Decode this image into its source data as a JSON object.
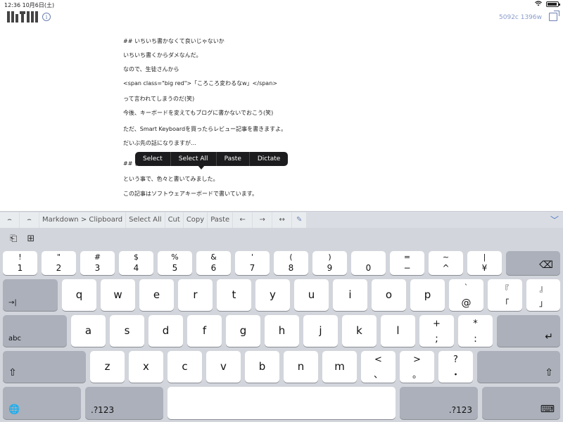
{
  "status_bar": {
    "time": "12:36",
    "date": "10月6日(土)"
  },
  "header": {
    "wordcount": "5092c 1396w"
  },
  "document": {
    "lines": [
      "## いちいち書かなくて良いじゃないか",
      "いちいち書くからダメなんだ。",
      "なので、生徒さんから",
      "<span class=\"big red\">「ころころ変わるなw」</span>",
      "って言われてしまうのだ(笑)",
      "今後、キーボードを変えてもブログに書かないでおこう(笑)",
      "ただ、Smart Keyboardを買ったらレビュー記事を書きますよ。",
      "だいぶ先の話になりますが…",
      "## ま",
      "という事で、色々と書いてみました。",
      "この記事はソフトウェアキーボードで書いています。"
    ]
  },
  "context_menu": [
    "Select",
    "Select All",
    "Paste",
    "Dictate"
  ],
  "toolbar": {
    "undo": "⌢",
    "redo": "⌢",
    "markdown": "Markdown > Clipboard",
    "select_all": "Select All",
    "cut": "Cut",
    "copy": "Copy",
    "paste": "Paste",
    "left": "←",
    "right": "→",
    "both": "↔",
    "pen": "✎",
    "collapse": "﹀"
  },
  "keyboard": {
    "tools": {
      "paste_icon": "⎗",
      "add_icon": "⊞"
    },
    "row1": [
      {
        "top": "!",
        "bot": "1"
      },
      {
        "top": "\"",
        "bot": "2"
      },
      {
        "top": "#",
        "bot": "3"
      },
      {
        "top": "$",
        "bot": "4"
      },
      {
        "top": "%",
        "bot": "5"
      },
      {
        "top": "&",
        "bot": "6"
      },
      {
        "top": "'",
        "bot": "7"
      },
      {
        "top": "(",
        "bot": "8"
      },
      {
        "top": ")",
        "bot": "9"
      },
      {
        "top": "",
        "bot": "0"
      },
      {
        "top": "=",
        "bot": "−"
      },
      {
        "top": "~",
        "bot": "^"
      },
      {
        "top": "|",
        "bot": "¥"
      }
    ],
    "delete": "⌫",
    "row2": [
      "q",
      "w",
      "e",
      "r",
      "t",
      "y",
      "u",
      "i",
      "o",
      "p"
    ],
    "row2_extra": [
      {
        "top": "`",
        "bot": "@"
      },
      {
        "top": "『",
        "bot": "「"
      },
      {
        "top": "』",
        "bot": "」"
      }
    ],
    "tab": "→|",
    "row3": [
      "a",
      "s",
      "d",
      "f",
      "g",
      "h",
      "j",
      "k",
      "l"
    ],
    "row3_extra": [
      {
        "top": "+",
        "bot": ";"
      },
      {
        "top": "*",
        "bot": ":"
      }
    ],
    "abc": "abc",
    "return": "↵",
    "row4": [
      "z",
      "x",
      "c",
      "v",
      "b",
      "n",
      "m"
    ],
    "row4_extra": [
      {
        "top": "<",
        "bot": "、"
      },
      {
        "top": ">",
        "bot": "。"
      },
      {
        "top": "?",
        "bot": "・"
      }
    ],
    "shift": "⇧",
    "globe": "🌐",
    "numbers": ".?123",
    "dismiss": "⌨"
  }
}
